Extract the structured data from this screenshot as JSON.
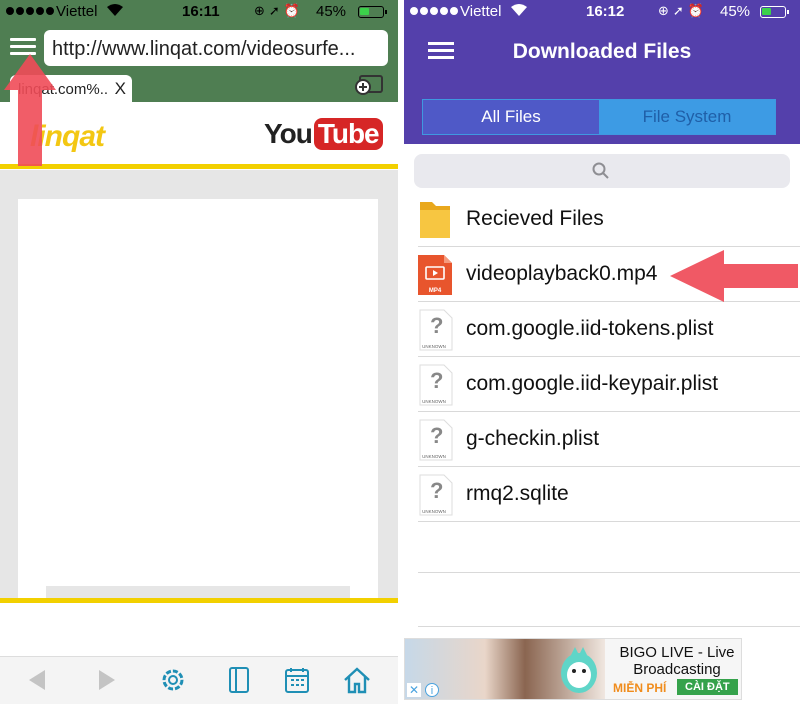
{
  "left": {
    "status": {
      "carrier": "Viettel",
      "time": "16:11",
      "battery": "45%",
      "battery_level": 0.45
    },
    "address": "http://www.linqat.com/videosurfe...",
    "tab": {
      "label": "linqat.com%..",
      "close": "X"
    },
    "site": {
      "logo": "linqat",
      "yt_you": "You",
      "yt_tube": "Tube"
    },
    "toolbar": [
      "back-icon",
      "forward-icon",
      "gear-icon",
      "bookmarks-icon",
      "calendar-icon",
      "home-icon"
    ],
    "colors": {
      "topbar": "#4f7e52",
      "accent": "#f2d000",
      "toolbar_icons": "#1f8fb5"
    }
  },
  "right": {
    "status": {
      "carrier": "Viettel",
      "time": "16:12",
      "battery": "45%",
      "battery_level": 0.45
    },
    "title": "Downloaded Files",
    "tabs": [
      "All Files",
      "File System"
    ],
    "files": [
      {
        "name": "Recieved Files",
        "icon": "folder-icon"
      },
      {
        "name": "videoplayback0.mp4",
        "icon": "mp4-file-icon",
        "badge": "MP4"
      },
      {
        "name": "com.google.iid-tokens.plist",
        "icon": "unknown-file-icon"
      },
      {
        "name": "com.google.iid-keypair.plist",
        "icon": "unknown-file-icon"
      },
      {
        "name": "g-checkin.plist",
        "icon": "unknown-file-icon"
      },
      {
        "name": "rmq2.sqlite",
        "icon": "unknown-file-icon"
      }
    ],
    "unknown_label": "UNKNOWN",
    "ad": {
      "title": "BIGO LIVE - Live Broadcasting",
      "free": "MIỄN PHÍ",
      "install": "CÀI ĐẶT"
    },
    "colors": {
      "header": "#5440ab",
      "tab_active": "#4f59c7",
      "tab_inactive": "#3d9be4"
    }
  }
}
